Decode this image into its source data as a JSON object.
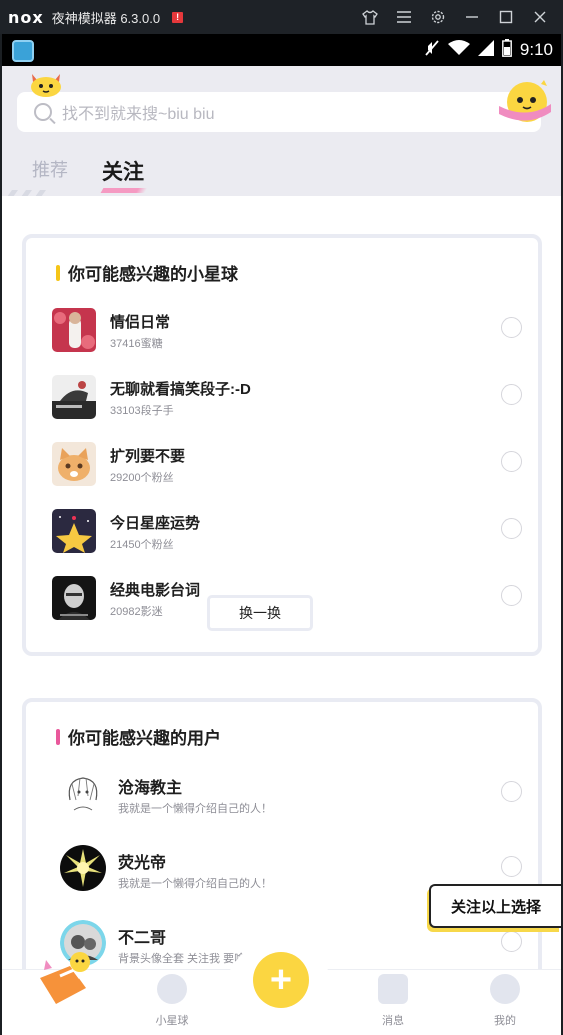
{
  "emulator": {
    "logo": "nox",
    "title": "夜神模拟器 6.3.0.0",
    "alert": "!"
  },
  "status_bar": {
    "time": "9:10"
  },
  "search": {
    "placeholder": "找不到就来搜~biu biu"
  },
  "tabs": [
    {
      "label": "推荐"
    },
    {
      "label": "关注"
    }
  ],
  "planets_card": {
    "title": "你可能感兴趣的小星球",
    "accent": "#f5c518",
    "items": [
      {
        "name": "情侣日常",
        "sub": "37416蜜糖"
      },
      {
        "name": "无聊就看搞笑段子:-D",
        "sub": "33103段子手"
      },
      {
        "name": "扩列要不要",
        "sub": "29200个粉丝"
      },
      {
        "name": "今日星座运势",
        "sub": "21450个粉丝"
      },
      {
        "name": "经典电影台词",
        "sub": "20982影迷"
      }
    ],
    "swap_label": "换一换"
  },
  "users_card": {
    "title": "你可能感兴趣的用户",
    "accent": "#e9589b",
    "items": [
      {
        "name": "沧海教主",
        "sub": "我就是一个懒得介绍自己的人！"
      },
      {
        "name": "荧光帝",
        "sub": "我就是一个懒得介绍自己的人！"
      },
      {
        "name": "不二哥",
        "sub": "背景头像全套 关注我 要啥有啥"
      }
    ]
  },
  "follow_selected_label": "关注以上选择",
  "bottom_nav": {
    "planet_label": "小星球",
    "messages_label": "消息",
    "me_label": "我的",
    "plus_symbol": "+"
  }
}
